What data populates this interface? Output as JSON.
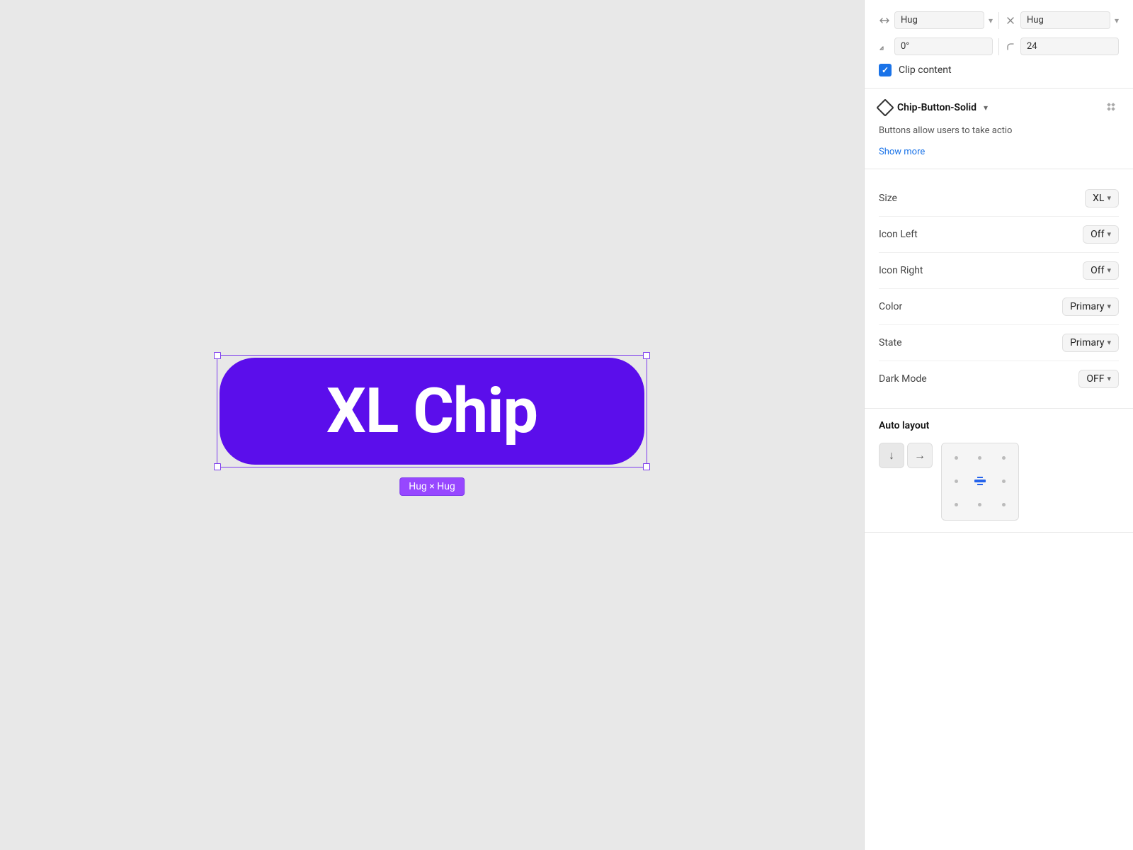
{
  "canvas": {
    "chip_text": "XL Chip",
    "hug_label": "Hug × Hug",
    "chip_bg_color": "#5b0eeb"
  },
  "panel": {
    "dimensions": {
      "width_icon": "↔",
      "width_value": "Hug",
      "height_icon": "↕",
      "height_value": "Hug",
      "rotation_icon": "↺",
      "rotation_value": "0°",
      "corner_icon": "⌒",
      "corner_value": "24",
      "clip_label": "Clip content"
    },
    "component": {
      "title": "Chip-Button-Solid",
      "description": "Buttons allow users to take actio",
      "show_more": "Show more"
    },
    "properties": [
      {
        "label": "Size",
        "value": "XL"
      },
      {
        "label": "Icon Left",
        "value": "Off"
      },
      {
        "label": "Icon Right",
        "value": "Off"
      },
      {
        "label": "Color",
        "value": "Primary"
      },
      {
        "label": "State",
        "value": "Primary"
      },
      {
        "label": "Dark Mode",
        "value": "OFF"
      }
    ],
    "auto_layout": {
      "title": "Auto layout"
    }
  }
}
